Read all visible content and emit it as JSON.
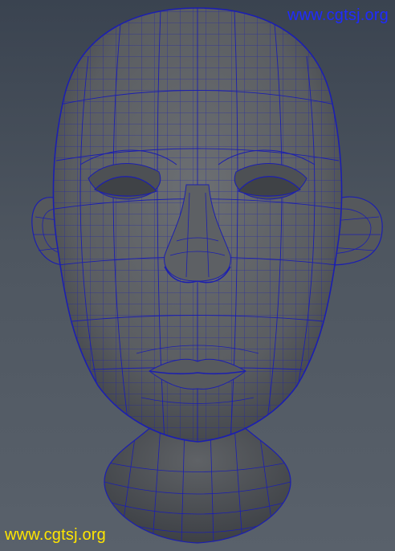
{
  "watermark_top": {
    "text": "www.cgtsj.org",
    "color": "#1f2bff"
  },
  "watermark_bottom": {
    "text": "www.cgtsj.org",
    "color": "#ffe600"
  },
  "viewport": {
    "subject": "polygon head model (wireframe on shaded)",
    "shade_color": "#5b5e62",
    "wire_color": "#1c1fb0"
  }
}
